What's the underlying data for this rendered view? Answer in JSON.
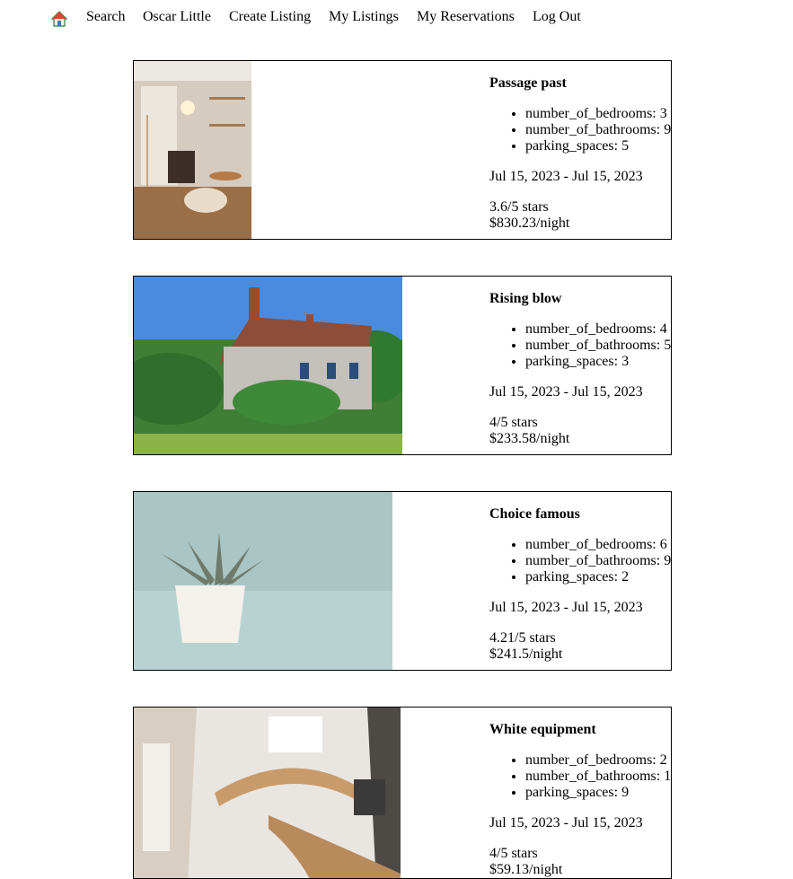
{
  "nav": {
    "home_icon": "house-icon",
    "links": [
      "Search",
      "Oscar Little",
      "Create Listing",
      "My Listings",
      "My Reservations",
      "Log Out"
    ]
  },
  "listings": [
    {
      "title": "Passage past",
      "features": [
        "number_of_bedrooms: 3",
        "number_of_bathrooms: 9",
        "parking_spaces: 5"
      ],
      "dates": "Jul 15, 2023 - Jul 15, 2023",
      "rating": "3.6/5 stars",
      "price": "$830.23/night"
    },
    {
      "title": "Rising blow",
      "features": [
        "number_of_bedrooms: 4",
        "number_of_bathrooms: 5",
        "parking_spaces: 3"
      ],
      "dates": "Jul 15, 2023 - Jul 15, 2023",
      "rating": "4/5 stars",
      "price": "$233.58/night"
    },
    {
      "title": "Choice famous",
      "features": [
        "number_of_bedrooms: 6",
        "number_of_bathrooms: 9",
        "parking_spaces: 2"
      ],
      "dates": "Jul 15, 2023 - Jul 15, 2023",
      "rating": "4.21/5 stars",
      "price": "$241.5/night"
    },
    {
      "title": "White equipment",
      "features": [
        "number_of_bedrooms: 2",
        "number_of_bathrooms: 1",
        "parking_spaces: 9"
      ],
      "dates": "Jul 15, 2023 - Jul 15, 2023",
      "rating": "4/5 stars",
      "price": "$59.13/night"
    }
  ]
}
